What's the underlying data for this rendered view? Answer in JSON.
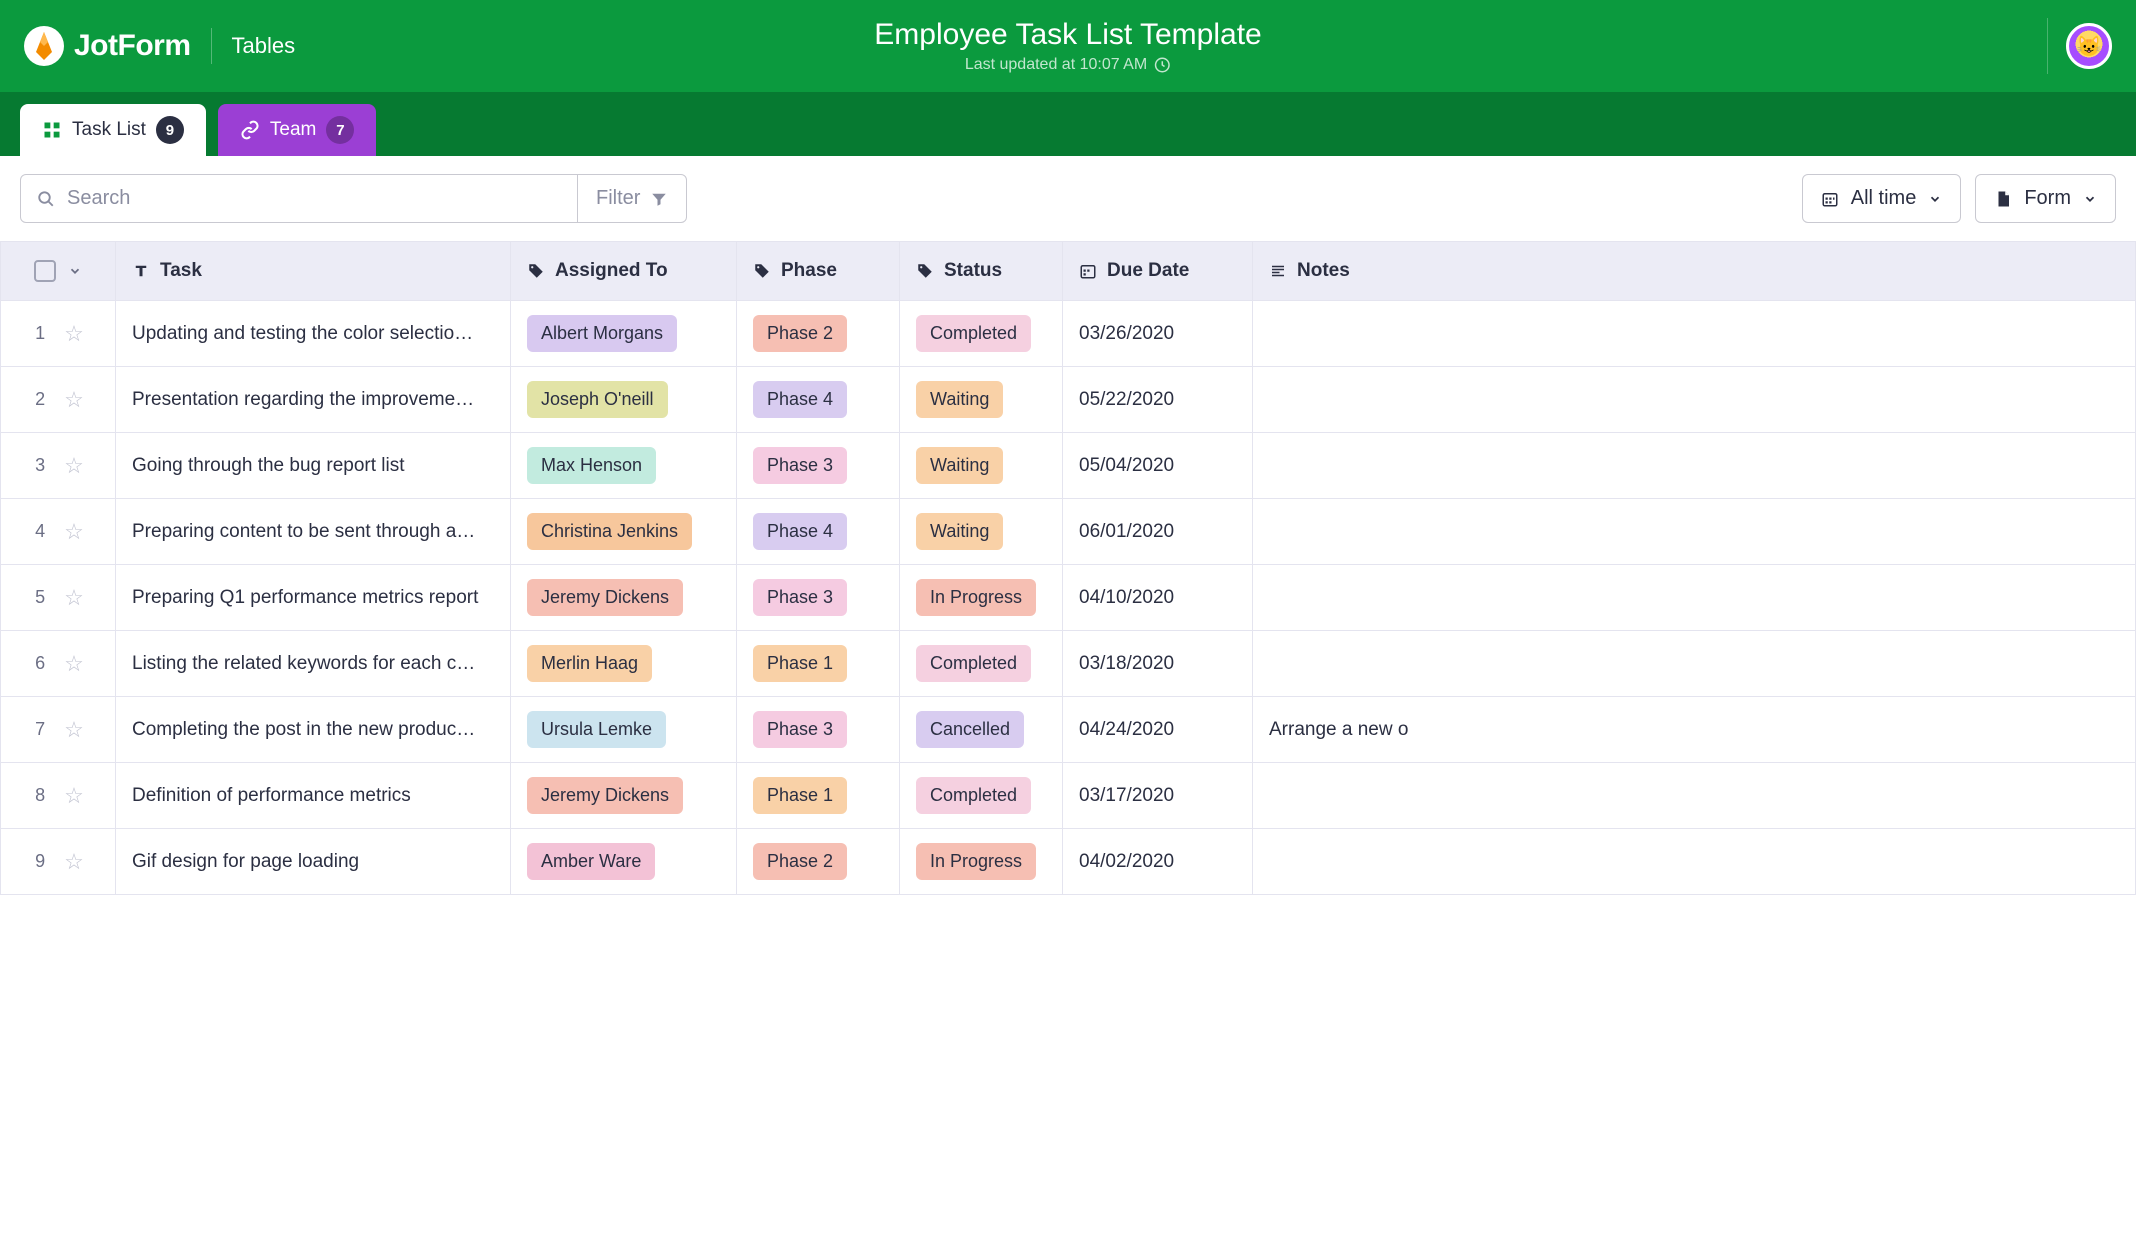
{
  "brand": {
    "name": "JotForm",
    "section": "Tables"
  },
  "header": {
    "title": "Employee Task List Template",
    "last_updated": "Last updated at 10:07 AM"
  },
  "tabs": {
    "task_list": {
      "label": "Task List",
      "count": "9"
    },
    "team": {
      "label": "Team",
      "count": "7"
    }
  },
  "toolbar": {
    "search_placeholder": "Search",
    "filter_label": "Filter",
    "time_label": "All time",
    "form_label": "Form"
  },
  "columns": {
    "task": "Task",
    "assigned": "Assigned To",
    "phase": "Phase",
    "status": "Status",
    "due": "Due Date",
    "notes": "Notes"
  },
  "tag_colors": {
    "assigned": {
      "Albert Morgans": "c-lavender",
      "Joseph O'neill": "c-olive",
      "Max Henson": "c-mint",
      "Christina Jenkins": "c-peach",
      "Jeremy Dickens": "c-salmon",
      "Merlin Haag": "c-lightorange",
      "Ursula Lemke": "c-lightblue",
      "Amber Ware": "c-pink"
    },
    "phase": {
      "Phase 1": "c-lightorange",
      "Phase 2": "c-salmon",
      "Phase 3": "c-rosepink",
      "Phase 4": "c-lilac"
    },
    "status": {
      "Completed": "c-lightpink",
      "Waiting": "c-lightorange",
      "In Progress": "c-salmon",
      "Cancelled": "c-lilac"
    }
  },
  "rows": [
    {
      "num": "1",
      "task": "Updating and testing the color selectio…",
      "assigned": "Albert Morgans",
      "phase": "Phase 2",
      "status": "Completed",
      "due": "03/26/2020",
      "notes": ""
    },
    {
      "num": "2",
      "task": "Presentation regarding the improveme…",
      "assigned": "Joseph O'neill",
      "phase": "Phase 4",
      "status": "Waiting",
      "due": "05/22/2020",
      "notes": ""
    },
    {
      "num": "3",
      "task": "Going through the bug report list",
      "assigned": "Max Henson",
      "phase": "Phase 3",
      "status": "Waiting",
      "due": "05/04/2020",
      "notes": ""
    },
    {
      "num": "4",
      "task": "Preparing content to be sent through a…",
      "assigned": "Christina Jenkins",
      "phase": "Phase 4",
      "status": "Waiting",
      "due": "06/01/2020",
      "notes": ""
    },
    {
      "num": "5",
      "task": "Preparing Q1 performance metrics report",
      "assigned": "Jeremy Dickens",
      "phase": "Phase 3",
      "status": "In Progress",
      "due": "04/10/2020",
      "notes": ""
    },
    {
      "num": "6",
      "task": "Listing the related keywords for each c…",
      "assigned": "Merlin Haag",
      "phase": "Phase 1",
      "status": "Completed",
      "due": "03/18/2020",
      "notes": ""
    },
    {
      "num": "7",
      "task": "Completing the post in the new produc…",
      "assigned": "Ursula Lemke",
      "phase": "Phase 3",
      "status": "Cancelled",
      "due": "04/24/2020",
      "notes": "Arrange a new o"
    },
    {
      "num": "8",
      "task": "Definition of performance metrics",
      "assigned": "Jeremy Dickens",
      "phase": "Phase 1",
      "status": "Completed",
      "due": "03/17/2020",
      "notes": ""
    },
    {
      "num": "9",
      "task": "Gif design for page loading",
      "assigned": "Amber Ware",
      "phase": "Phase 2",
      "status": "In Progress",
      "due": "04/02/2020",
      "notes": ""
    }
  ]
}
